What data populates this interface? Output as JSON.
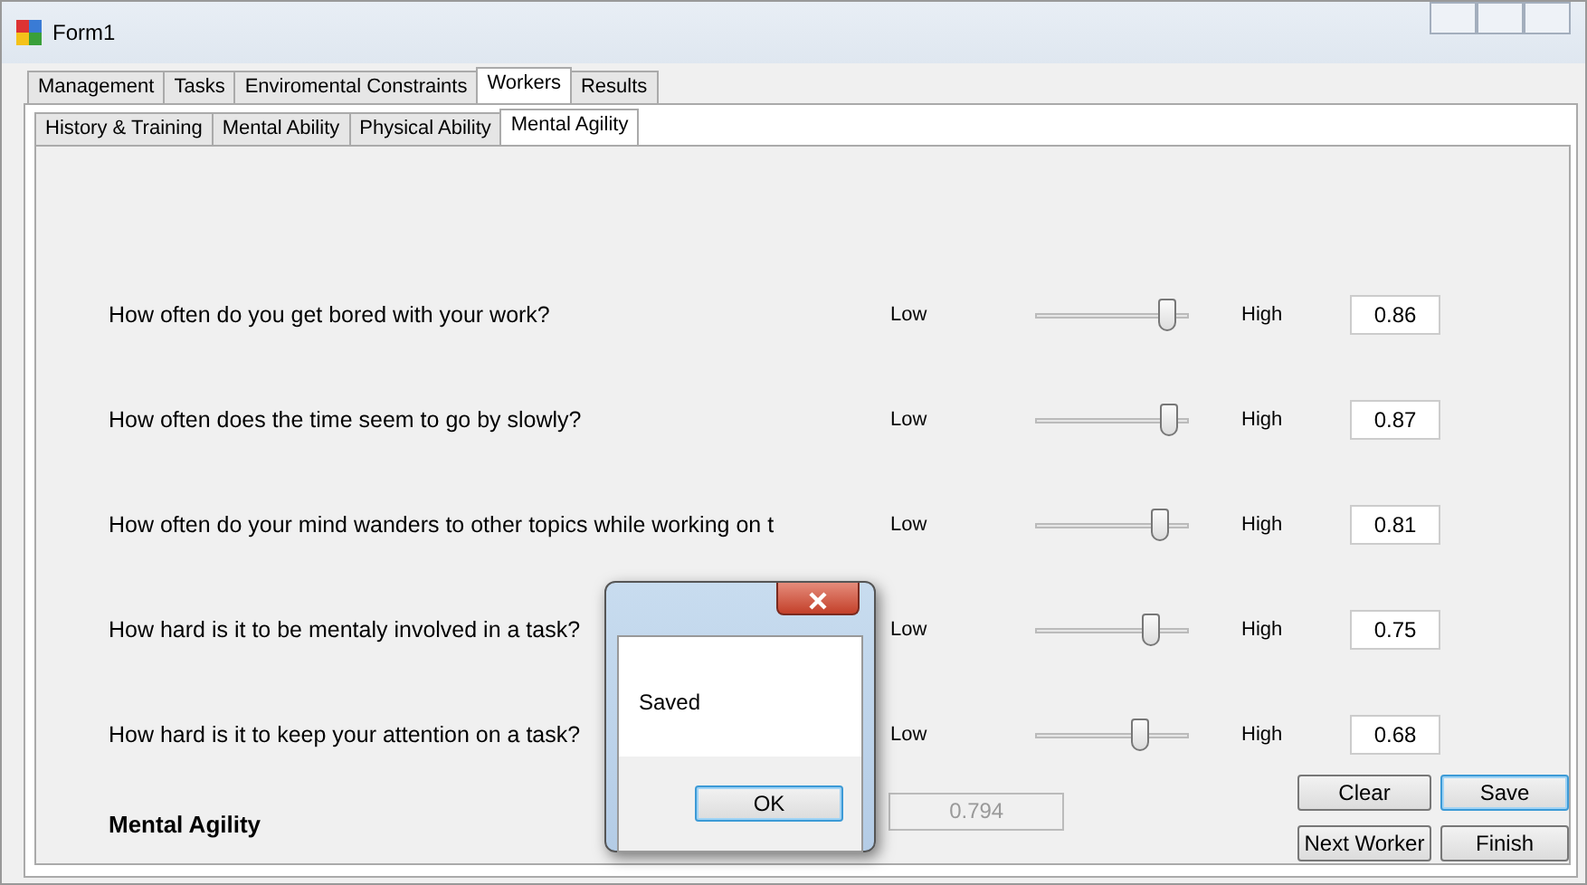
{
  "window": {
    "title": "Form1"
  },
  "tabs": [
    {
      "label": "Management",
      "selected": false
    },
    {
      "label": "Tasks",
      "selected": false
    },
    {
      "label": "Enviromental Constraints",
      "selected": false
    },
    {
      "label": "Workers",
      "selected": true
    },
    {
      "label": "Results",
      "selected": false
    }
  ],
  "subtabs": [
    {
      "label": "History & Training",
      "selected": false
    },
    {
      "label": "Mental Ability",
      "selected": false
    },
    {
      "label": "Physical Ability",
      "selected": false
    },
    {
      "label": "Mental Agility",
      "selected": true
    }
  ],
  "questions": [
    {
      "text": "How often do you get bored with your work?",
      "low": "Low",
      "high": "High",
      "level": 0.86,
      "value": "0.86"
    },
    {
      "text": "How often does the time seem to go by slowly?",
      "low": "Low",
      "high": "High",
      "level": 0.87,
      "value": "0.87"
    },
    {
      "text": "How often do your mind wanders to other topics while working on t",
      "low": "Low",
      "high": "High",
      "level": 0.81,
      "value": "0.81"
    },
    {
      "text": "How hard is it to be mentaly involved in a task?",
      "low": "Low",
      "high": "High",
      "level": 0.75,
      "value": "0.75"
    },
    {
      "text": "How hard is it to keep your attention on a task?",
      "low": "Low",
      "high": "High",
      "level": 0.68,
      "value": "0.68"
    }
  ],
  "result": {
    "label": "Mental Agility",
    "value": "0.794",
    "disabled": true
  },
  "buttons": [
    {
      "label": "Clear",
      "focused": false
    },
    {
      "label": "Save",
      "focused": true
    },
    {
      "label": "Next Worker",
      "focused": false
    },
    {
      "label": "Finish",
      "focused": false
    }
  ],
  "dialog": {
    "message": "Saved",
    "button": "OK"
  }
}
